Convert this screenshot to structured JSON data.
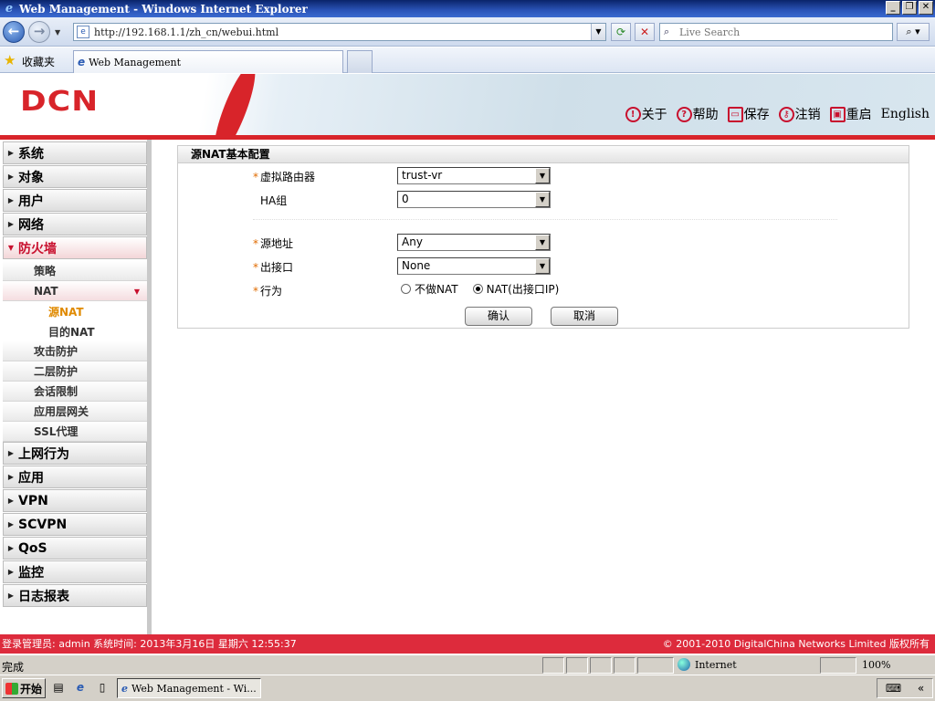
{
  "browser": {
    "window_title": "Web Management - Windows Internet Explorer",
    "url": "http://192.168.1.1/zh_cn/webui.html",
    "search_placeholder": "Live Search",
    "favorites_label": "收藏夹",
    "tab_title": "Web Management",
    "status_text": "完成",
    "zone_text": "Internet",
    "zoom_text": "100%",
    "win_buttons": [
      "_",
      "❐",
      "✕"
    ]
  },
  "taskbar": {
    "start_label": "开始",
    "task_title": "Web Management - Wi..."
  },
  "header": {
    "logo": "DCN",
    "links": [
      {
        "icon": "info-icon",
        "label": "关于"
      },
      {
        "icon": "help-icon",
        "label": "帮助"
      },
      {
        "icon": "save-icon",
        "label": "保存"
      },
      {
        "icon": "key-icon",
        "label": "注销"
      },
      {
        "icon": "restart-icon",
        "label": "重启"
      }
    ],
    "language": "English"
  },
  "sidebar": {
    "top": [
      {
        "label": "系统"
      },
      {
        "label": "对象"
      },
      {
        "label": "用户"
      },
      {
        "label": "网络"
      },
      {
        "label": "防火墙"
      }
    ],
    "firewall_sub": [
      {
        "label": "策略"
      },
      {
        "label": "NAT"
      }
    ],
    "nat_sub": [
      {
        "label": "源NAT"
      },
      {
        "label": "目的NAT"
      }
    ],
    "firewall_sub2": [
      {
        "label": "攻击防护"
      },
      {
        "label": "二层防护"
      },
      {
        "label": "会话限制"
      },
      {
        "label": "应用层网关"
      },
      {
        "label": "SSL代理"
      }
    ],
    "bottom": [
      {
        "label": "上网行为"
      },
      {
        "label": "应用"
      },
      {
        "label": "VPN"
      },
      {
        "label": "SCVPN"
      },
      {
        "label": "QoS"
      },
      {
        "label": "监控"
      },
      {
        "label": "日志报表"
      }
    ]
  },
  "form": {
    "title": "源NAT基本配置",
    "virtual_router": {
      "label": "虚拟路由器",
      "value": "trust-vr"
    },
    "ha_group": {
      "label": "HA组",
      "value": "0"
    },
    "source_address": {
      "label": "源地址",
      "value": "Any"
    },
    "egress_interface": {
      "label": "出接口",
      "value": "None"
    },
    "action": {
      "label": "行为",
      "options": [
        "不做NAT",
        "NAT(出接口IP)"
      ],
      "selected": "NAT(出接口IP)"
    },
    "confirm_label": "确认",
    "cancel_label": "取消",
    "required_mark": "*"
  },
  "footer": {
    "left": "登录管理员: admin 系统时间: 2013年3月16日 星期六 12:55:37",
    "right": "© 2001-2010 DigitalChina Networks Limited 版权所有"
  },
  "colors": {
    "brand_red": "#d8242a",
    "footer_red": "#dd2b3c",
    "active_orange": "#e08a00"
  }
}
